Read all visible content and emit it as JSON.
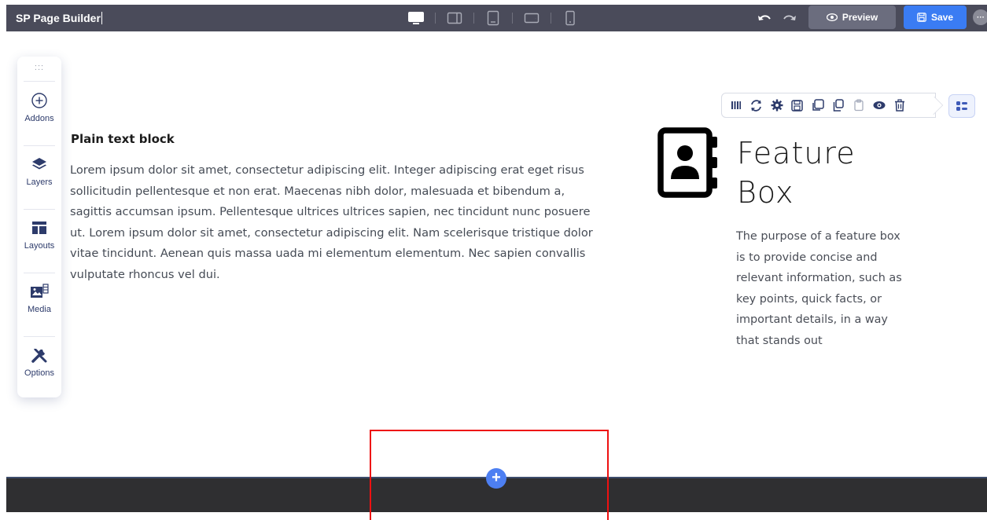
{
  "app": {
    "title": "SP Page Builder"
  },
  "devices": [
    "desktop-icon",
    "laptop-icon",
    "tablet-icon",
    "tablet-landscape-icon",
    "mobile-icon"
  ],
  "toolbar": {
    "preview_label": "Preview",
    "save_label": "Save",
    "more_label": "···"
  },
  "sidebar": {
    "handle": ":::",
    "items": [
      {
        "label": "Addons",
        "icon": "plus-circle-icon"
      },
      {
        "label": "Layers",
        "icon": "layers-icon"
      },
      {
        "label": "Layouts",
        "icon": "layout-icon"
      },
      {
        "label": "Media",
        "icon": "media-icon"
      },
      {
        "label": "Options",
        "icon": "tools-icon"
      }
    ]
  },
  "text_block": {
    "heading": "Plain text block",
    "lines": [
      "Lorem ipsum dolor sit amet, consectetur adipiscing elit. Integer adipiscing erat eget risus",
      "sollicitudin pellentesque et non erat. Maecenas nibh dolor, malesuada et bibendum a,",
      "sagittis accumsan ipsum. Pellentesque ultrices ultrices sapien, nec tincidunt nunc posuere",
      "ut. Lorem ipsum dolor sit amet, consectetur adipiscing elit. Nam scelerisque tristique dolor",
      "vitae tincidunt. Aenean quis massa uada mi elementum elementum. Nec sapien convallis",
      "vulputate rhoncus vel dui."
    ]
  },
  "feature_box": {
    "title_lines": [
      "Feature",
      "Box"
    ],
    "body_lines": [
      "The purpose of a feature box",
      "is to provide concise and",
      "relevant information, such as",
      "key points, quick facts, or",
      "important details, in a way",
      "that stands out"
    ]
  },
  "addon_toolbar": {
    "icons": [
      "columns-icon",
      "refresh-icon",
      "gear-icon",
      "save-icon",
      "copy-icon",
      "duplicate-icon",
      "paste-icon",
      "eye-icon",
      "trash-icon"
    ]
  },
  "bottom": {
    "add_label": "+"
  },
  "colors": {
    "topbar": "#4a4b5a",
    "save": "#3a7cf3",
    "accent": "#4d7ff2",
    "highlight": "#ee1111"
  }
}
